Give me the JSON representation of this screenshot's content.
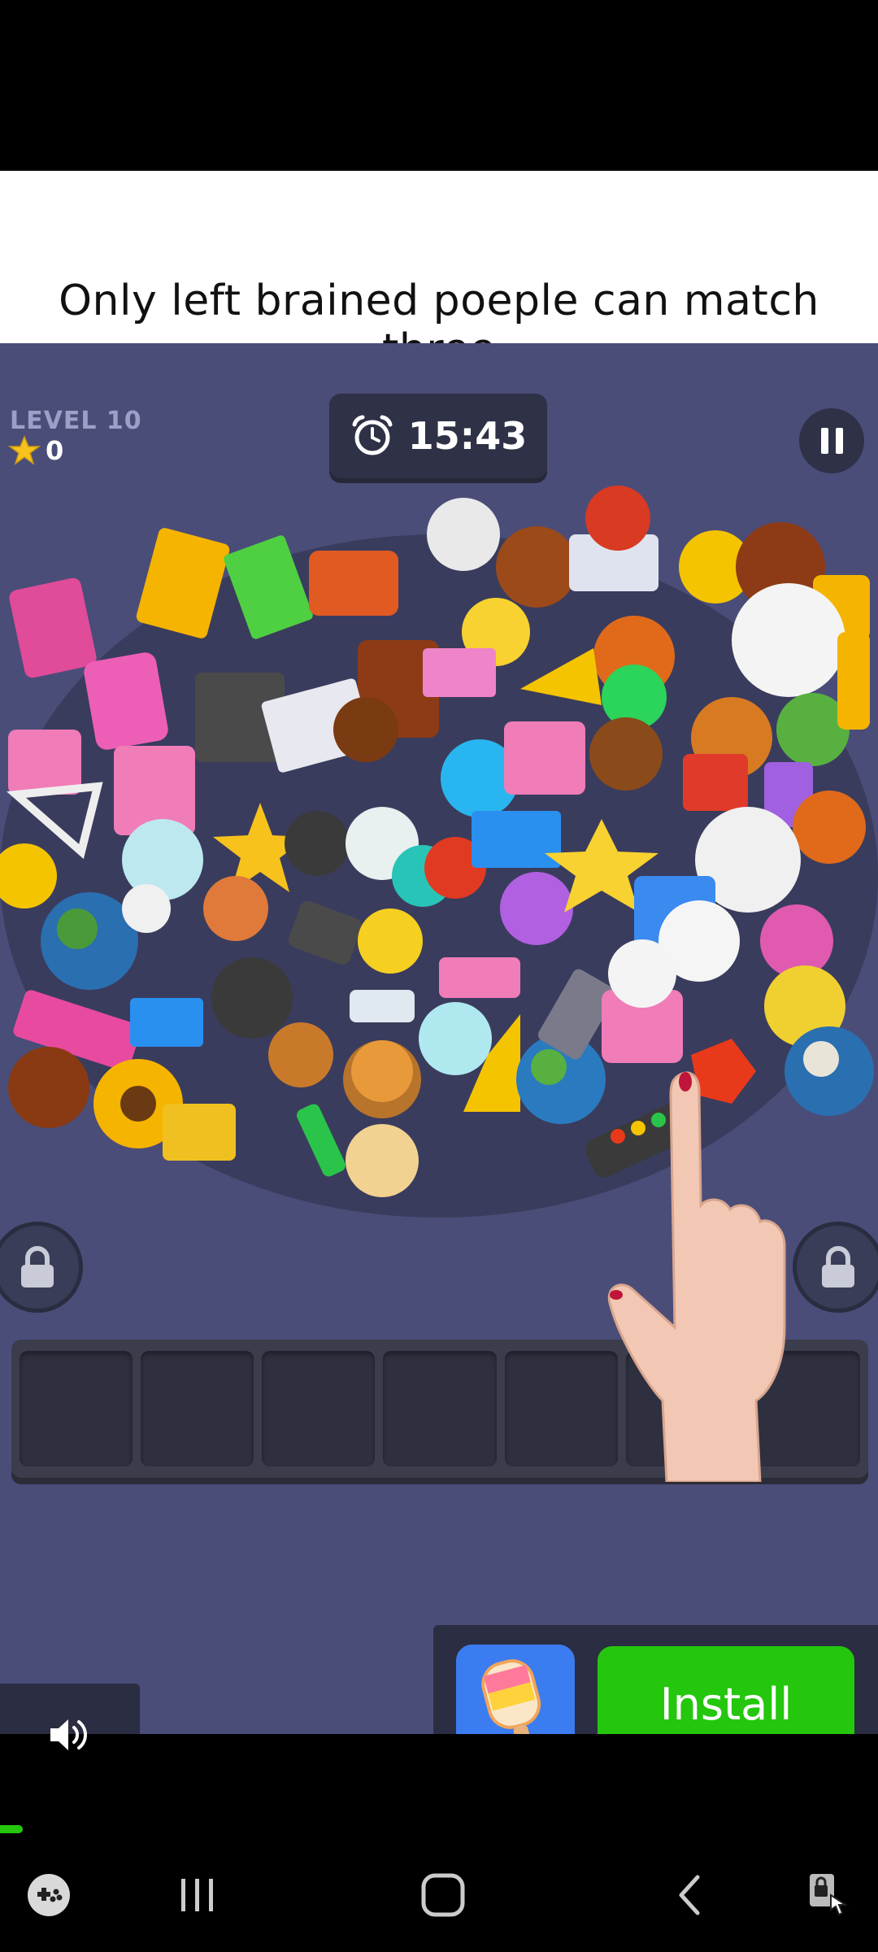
{
  "caption": "Only left brained poeple can match three",
  "game": {
    "level_label": "LEVEL 10",
    "stars": "0",
    "timer": "15:43",
    "tray_slots": 7,
    "colors": {
      "background": "#4a4d78",
      "panel": "#2f3147",
      "tray": "#3b3d4c",
      "star": "#f7c21c"
    }
  },
  "ad": {
    "install_label": "Install",
    "install_color": "#24c70d",
    "app_icon": "popsicle-icon"
  },
  "nav": {
    "items": [
      "game-launcher-icon",
      "recent-apps-icon",
      "home-icon",
      "back-icon",
      "screen-lock-icon"
    ]
  }
}
